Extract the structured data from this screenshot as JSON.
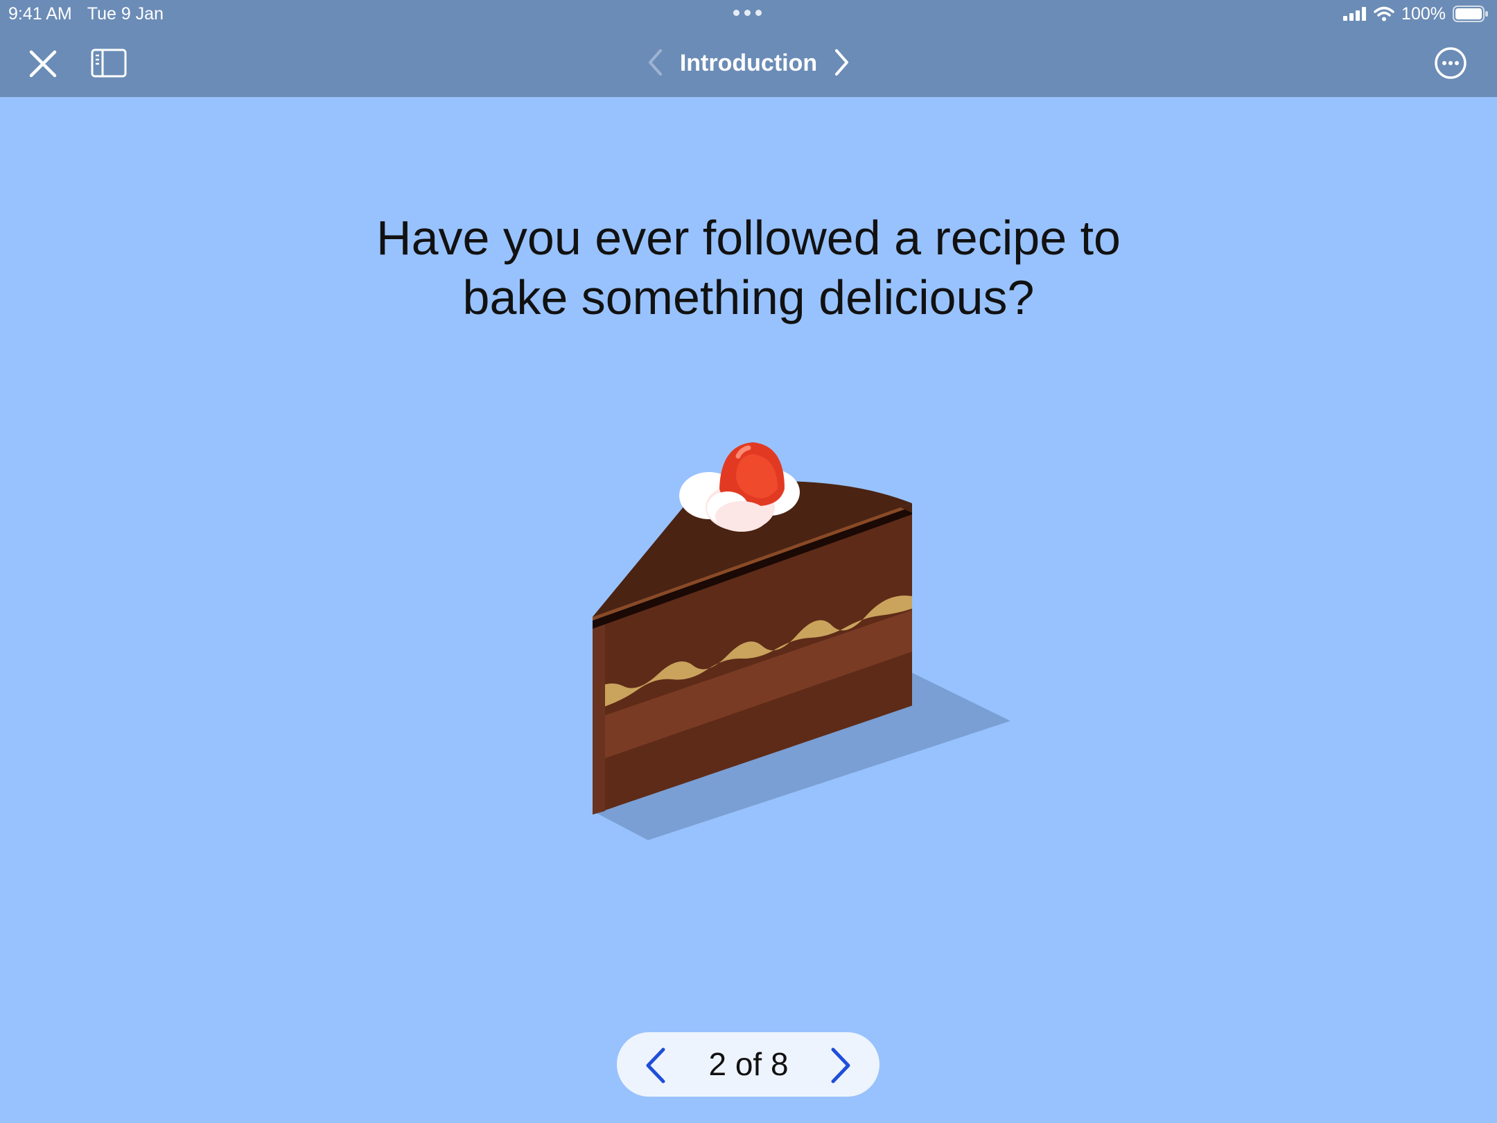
{
  "status_bar": {
    "time": "9:41 AM",
    "date": "Tue 9 Jan",
    "battery": "100%",
    "icons": [
      "signal-icon",
      "wifi-icon",
      "battery-icon"
    ]
  },
  "toolbar": {
    "close_icon": "close-icon",
    "sidebar_icon": "sidebar-icon",
    "title": "Introduction",
    "more_icon": "more-icon"
  },
  "content": {
    "question_line1": "Have you ever followed a recipe to",
    "question_line2": "bake something delicious?",
    "illustration": "cake-slice-illustration"
  },
  "pager": {
    "label": "2 of 8",
    "current_page": 2,
    "total_pages": 8
  },
  "colors": {
    "background": "#98c2fd",
    "toolbar": "#6b8cb6",
    "pager_bg": "#eef4fd",
    "accent": "#1f4fd8"
  }
}
